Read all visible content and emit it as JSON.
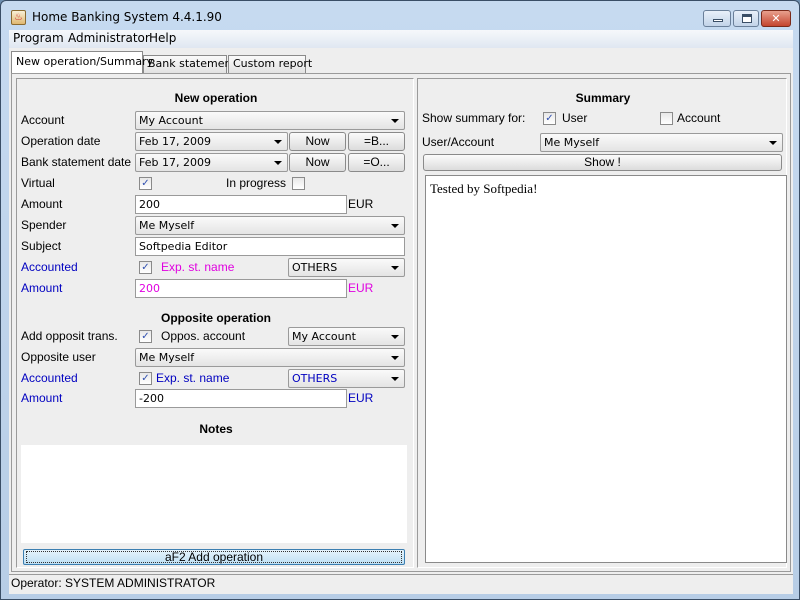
{
  "window": {
    "title": "Home Banking System 4.4.1.90",
    "controls": {
      "minimize": "minimize-icon",
      "maximize": "maximize-icon",
      "close": "close-icon"
    }
  },
  "menubar": [
    "Program",
    "Administrator",
    "Help"
  ],
  "tabs": [
    {
      "label": "New operation/Summary",
      "active": true
    },
    {
      "label": "Bank statement",
      "active": false
    },
    {
      "label": "Custom report",
      "active": false
    }
  ],
  "new_operation": {
    "title": "New operation",
    "account_label": "Account",
    "account_value": "My Account",
    "operation_date_label": "Operation date",
    "operation_date_value": "Feb 17, 2009",
    "now_label": "Now",
    "eq_b_label": "=B...",
    "bank_statement_date_label": "Bank statement date",
    "bank_statement_date_value": "Feb 17, 2009",
    "eq_o_label": "=O...",
    "virtual_label": "Virtual",
    "virtual_checked": true,
    "in_progress_label": "In progress",
    "in_progress_checked": false,
    "amount_label": "Amount",
    "amount_value": "200",
    "currency": "EUR",
    "spender_label": "Spender",
    "spender_value": "Me Myself",
    "subject_label": "Subject",
    "subject_value": "Softpedia Editor",
    "accounted_label": "Accounted",
    "accounted_checked": true,
    "exp_st_name_label": "Exp. st. name",
    "exp_st_name_value": "OTHERS",
    "acc_amount_label": "Amount",
    "acc_amount_value": "200",
    "acc_currency": "EUR"
  },
  "opposite_operation": {
    "title": "Opposite operation",
    "add_opposit_label": "Add opposit trans.",
    "add_opposit_checked": true,
    "oppos_account_label": "Oppos. account",
    "oppos_account_value": "My Account",
    "opposite_user_label": "Opposite user",
    "opposite_user_value": "Me Myself",
    "accounted_label": "Accounted",
    "accounted_checked": true,
    "exp_st_name_label": "Exp. st. name",
    "exp_st_name_value": "OTHERS",
    "amount_label": "Amount",
    "amount_value": "-200",
    "currency": "EUR"
  },
  "notes": {
    "title": "Notes",
    "value": ""
  },
  "add_operation_label": "aF2 Add operation",
  "summary": {
    "title": "Summary",
    "show_for_label": "Show summary for:",
    "user_label": "User",
    "user_checked": true,
    "account_label": "Account",
    "account_checked": false,
    "user_account_label": "User/Account",
    "user_account_value": "Me Myself",
    "show_label": "Show !",
    "output_text": "Tested by Softpedia!"
  },
  "status": "Operator: SYSTEM ADMINISTRATOR",
  "colors": {
    "accounted_blue": "#0000c0",
    "expense_magenta": "#e000e0"
  }
}
